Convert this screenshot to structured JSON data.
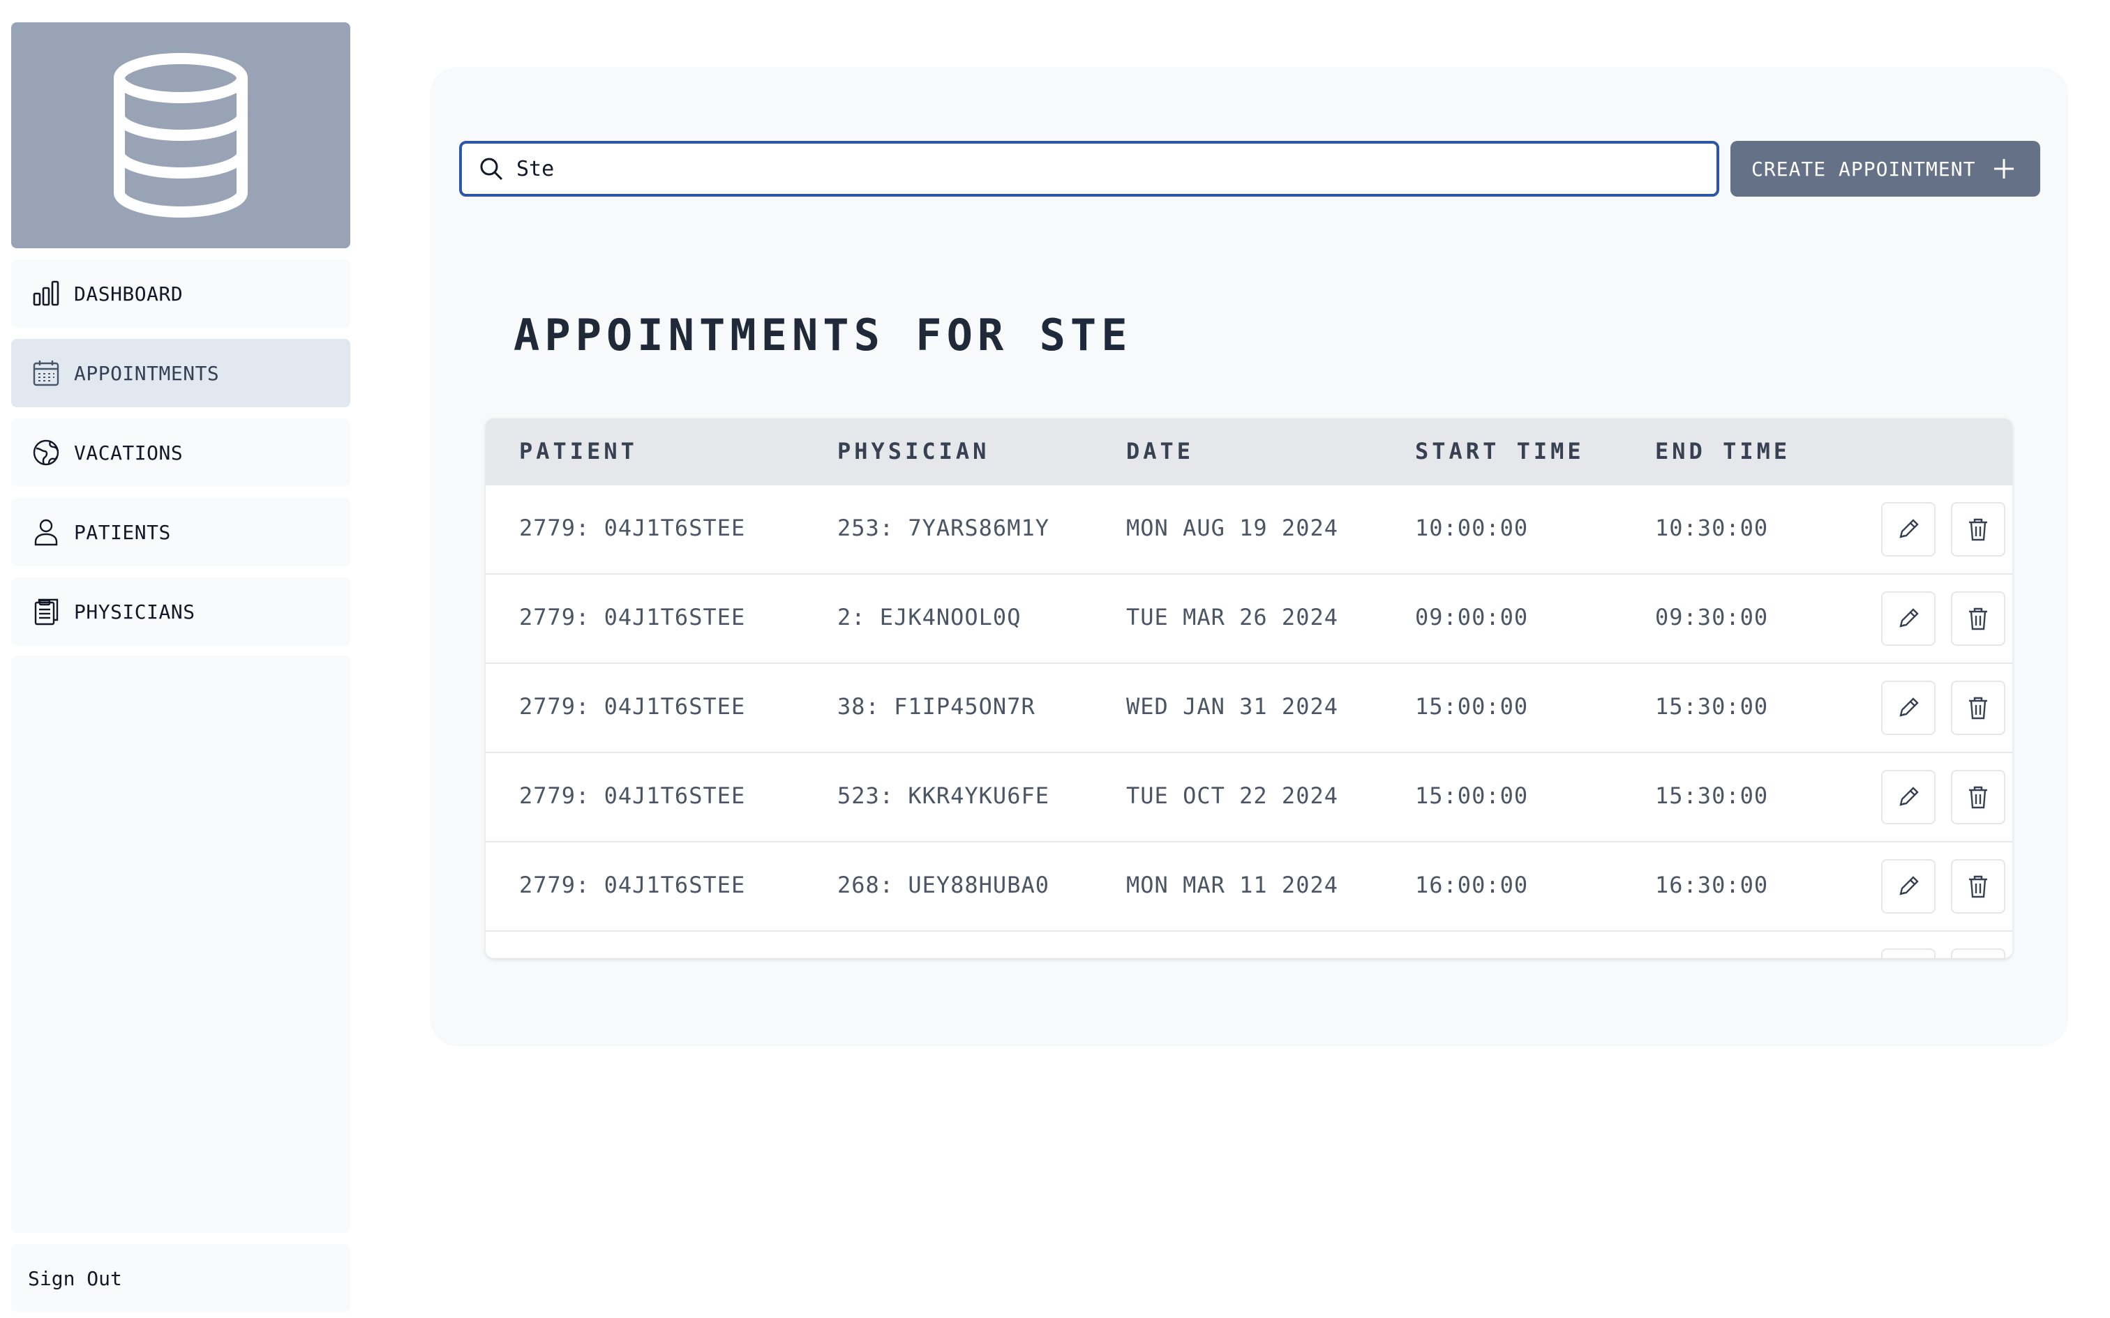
{
  "sidebar": {
    "logo_icon": "database-icon",
    "items": [
      {
        "label": "DASHBOARD",
        "icon": "bar-chart-icon",
        "active": false
      },
      {
        "label": "APPOINTMENTS",
        "icon": "calendar-icon",
        "active": true
      },
      {
        "label": "VACATIONS",
        "icon": "globe-icon",
        "active": false
      },
      {
        "label": "PATIENTS",
        "icon": "user-icon",
        "active": false
      },
      {
        "label": "PHYSICIANS",
        "icon": "clipboard-icon",
        "active": false
      }
    ],
    "sign_out_label": "Sign Out"
  },
  "search": {
    "value": "Ste",
    "placeholder": ""
  },
  "toolbar": {
    "create_label": "CREATE APPOINTMENT"
  },
  "heading": {
    "prefix": "APPOINTMENTS FOR ",
    "term": "STE"
  },
  "table": {
    "columns": [
      "PATIENT",
      "PHYSICIAN",
      "DATE",
      "START TIME",
      "END TIME"
    ],
    "rows": [
      {
        "patient": "2779: 04J1T6STEE",
        "physician": "253: 7YARS86M1Y",
        "date": "MON AUG 19 2024",
        "start": "10:00:00",
        "end": "10:30:00"
      },
      {
        "patient": "2779: 04J1T6STEE",
        "physician": "2: EJK4NOOL0Q",
        "date": "TUE MAR 26 2024",
        "start": "09:00:00",
        "end": "09:30:00"
      },
      {
        "patient": "2779: 04J1T6STEE",
        "physician": "38: F1IP45ON7R",
        "date": "WED JAN 31 2024",
        "start": "15:00:00",
        "end": "15:30:00"
      },
      {
        "patient": "2779: 04J1T6STEE",
        "physician": "523: KKR4YKU6FE",
        "date": "TUE OCT 22 2024",
        "start": "15:00:00",
        "end": "15:30:00"
      },
      {
        "patient": "2779: 04J1T6STEE",
        "physician": "268: UEY88HUBA0",
        "date": "MON MAR 11 2024",
        "start": "16:00:00",
        "end": "16:30:00"
      }
    ],
    "partial_row": {
      "patient": "",
      "physician": "",
      "date": "",
      "start": "",
      "end": ""
    }
  },
  "colors": {
    "accent_border": "#2f56a6",
    "button_bg": "#647186",
    "logo_bg": "#98a3b5",
    "active_nav_bg": "#e2e8f0"
  }
}
